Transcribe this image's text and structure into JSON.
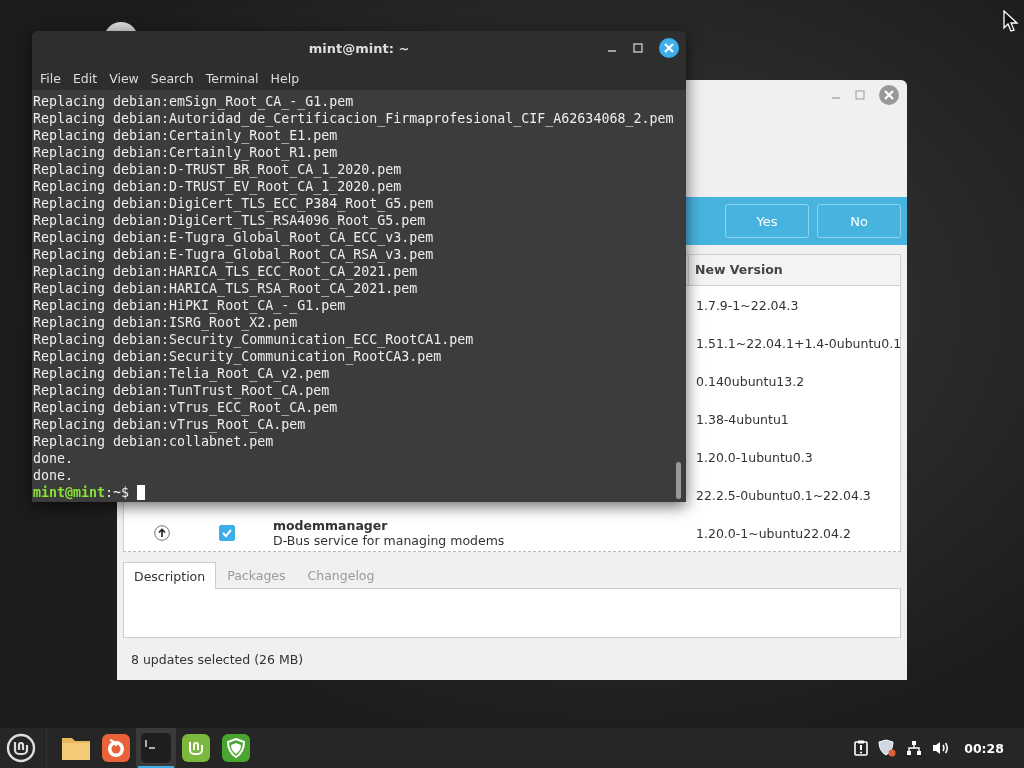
{
  "update_manager": {
    "buttons": [
      "Yes",
      "No"
    ],
    "table": {
      "columns": [
        {
          "label": "New Version"
        }
      ],
      "rows": [
        {
          "version": "1.7.9-1~22.04.3"
        },
        {
          "version": "1.51.1~22.04.1+1.4-0ubuntu0.1"
        },
        {
          "version": "0.140ubuntu13.2"
        },
        {
          "version": "1.38-4ubuntu1"
        },
        {
          "version": "1.20.0-1ubuntu0.3"
        },
        {
          "version": "22.2.5-0ubuntu0.1~22.04.3"
        },
        {
          "name": "modemmanager",
          "description": "D-Bus service for managing modems",
          "checked": true,
          "version": "1.20.0-1~ubuntu22.04.2"
        }
      ]
    },
    "tabs": [
      {
        "label": "Description",
        "selected": true
      },
      {
        "label": "Packages",
        "selected": false
      },
      {
        "label": "Changelog",
        "selected": false
      }
    ],
    "status_bar": "8 updates selected (26 MB)"
  },
  "terminal": {
    "title": "mint@mint: ~",
    "menu": [
      "File",
      "Edit",
      "View",
      "Search",
      "Terminal",
      "Help"
    ],
    "lines": [
      "Replacing debian:emSign_Root_CA_-_G1.pem",
      "Replacing debian:Autoridad_de_Certificacion_Firmaprofesional_CIF_A62634068_2.pem",
      "Replacing debian:Certainly_Root_E1.pem",
      "Replacing debian:Certainly_Root_R1.pem",
      "Replacing debian:D-TRUST_BR_Root_CA_1_2020.pem",
      "Replacing debian:D-TRUST_EV_Root_CA_1_2020.pem",
      "Replacing debian:DigiCert_TLS_ECC_P384_Root_G5.pem",
      "Replacing debian:DigiCert_TLS_RSA4096_Root_G5.pem",
      "Replacing debian:E-Tugra_Global_Root_CA_ECC_v3.pem",
      "Replacing debian:E-Tugra_Global_Root_CA_RSA_v3.pem",
      "Replacing debian:HARICA_TLS_ECC_Root_CA_2021.pem",
      "Replacing debian:HARICA_TLS_RSA_Root_CA_2021.pem",
      "Replacing debian:HiPKI_Root_CA_-_G1.pem",
      "Replacing debian:ISRG_Root_X2.pem",
      "Replacing debian:Security_Communication_ECC_RootCA1.pem",
      "Replacing debian:Security_Communication_RootCA3.pem",
      "Replacing debian:Telia_Root_CA_v2.pem",
      "Replacing debian:TunTrust_Root_CA.pem",
      "Replacing debian:vTrus_ECC_Root_CA.pem",
      "Replacing debian:vTrus_Root_CA.pem",
      "Replacing debian:collabnet.pem",
      "done.",
      "done."
    ],
    "prompt": {
      "user": "mint@mint",
      "path": ":~$"
    }
  },
  "taskbar": {
    "apps": [
      {
        "kind": "folder",
        "active": false
      },
      {
        "kind": "browser",
        "active": false
      },
      {
        "kind": "terminal",
        "active": true
      },
      {
        "kind": "mint",
        "active": false
      },
      {
        "kind": "shield",
        "active": false
      }
    ],
    "clock": "00:28"
  }
}
